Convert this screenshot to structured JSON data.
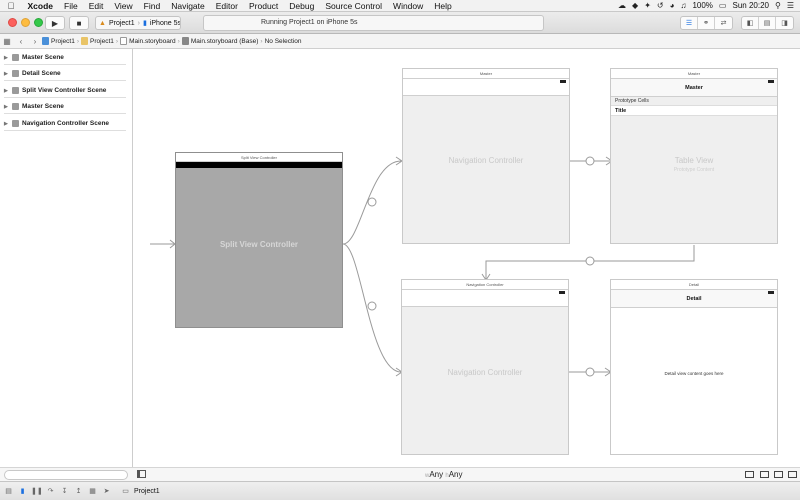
{
  "menubar": {
    "items": [
      "Xcode",
      "File",
      "Edit",
      "View",
      "Find",
      "Navigate",
      "Editor",
      "Product",
      "Debug",
      "Source Control",
      "Window",
      "Help"
    ],
    "battery": "100%",
    "clock": "Sun 20:20"
  },
  "toolbar": {
    "scheme_project": "Project1",
    "scheme_device": "iPhone 5s",
    "activity_text": "Running Project1 on iPhone 5s"
  },
  "jumpbar": {
    "crumbs": [
      "Project1",
      "Project1",
      "Main.storyboard",
      "Main.storyboard (Base)",
      "No Selection"
    ]
  },
  "outline": {
    "scenes": [
      "Master Scene",
      "Detail Scene",
      "Split View Controller Scene",
      "Master Scene",
      "Navigation Controller Scene"
    ]
  },
  "canvas": {
    "split": {
      "header": "Split View Controller",
      "label": "Split View Controller"
    },
    "nav_top": {
      "header": "Master",
      "label": "Navigation Controller"
    },
    "table": {
      "header": "Master",
      "nav_title": "Master",
      "prototype_cells": "Prototype Cells",
      "cell_title": "Title",
      "label": "Table View",
      "sublabel": "Prototype Content"
    },
    "nav_bottom": {
      "header": "Navigation Controller",
      "label": "Navigation Controller"
    },
    "detail": {
      "header": "Detail",
      "nav_title": "Detail",
      "content": "Detail view content goes here"
    }
  },
  "size_class": {
    "w_prefix": "w",
    "w_value": "Any",
    "h_prefix": "h",
    "h_value": "Any"
  },
  "statusbar": {
    "target": "Project1"
  },
  "colors": {
    "accent": "#1a6fe0",
    "split_gray": "#a8a8a8",
    "scene_bg": "#efefef",
    "segue": "#9a9a9a"
  }
}
